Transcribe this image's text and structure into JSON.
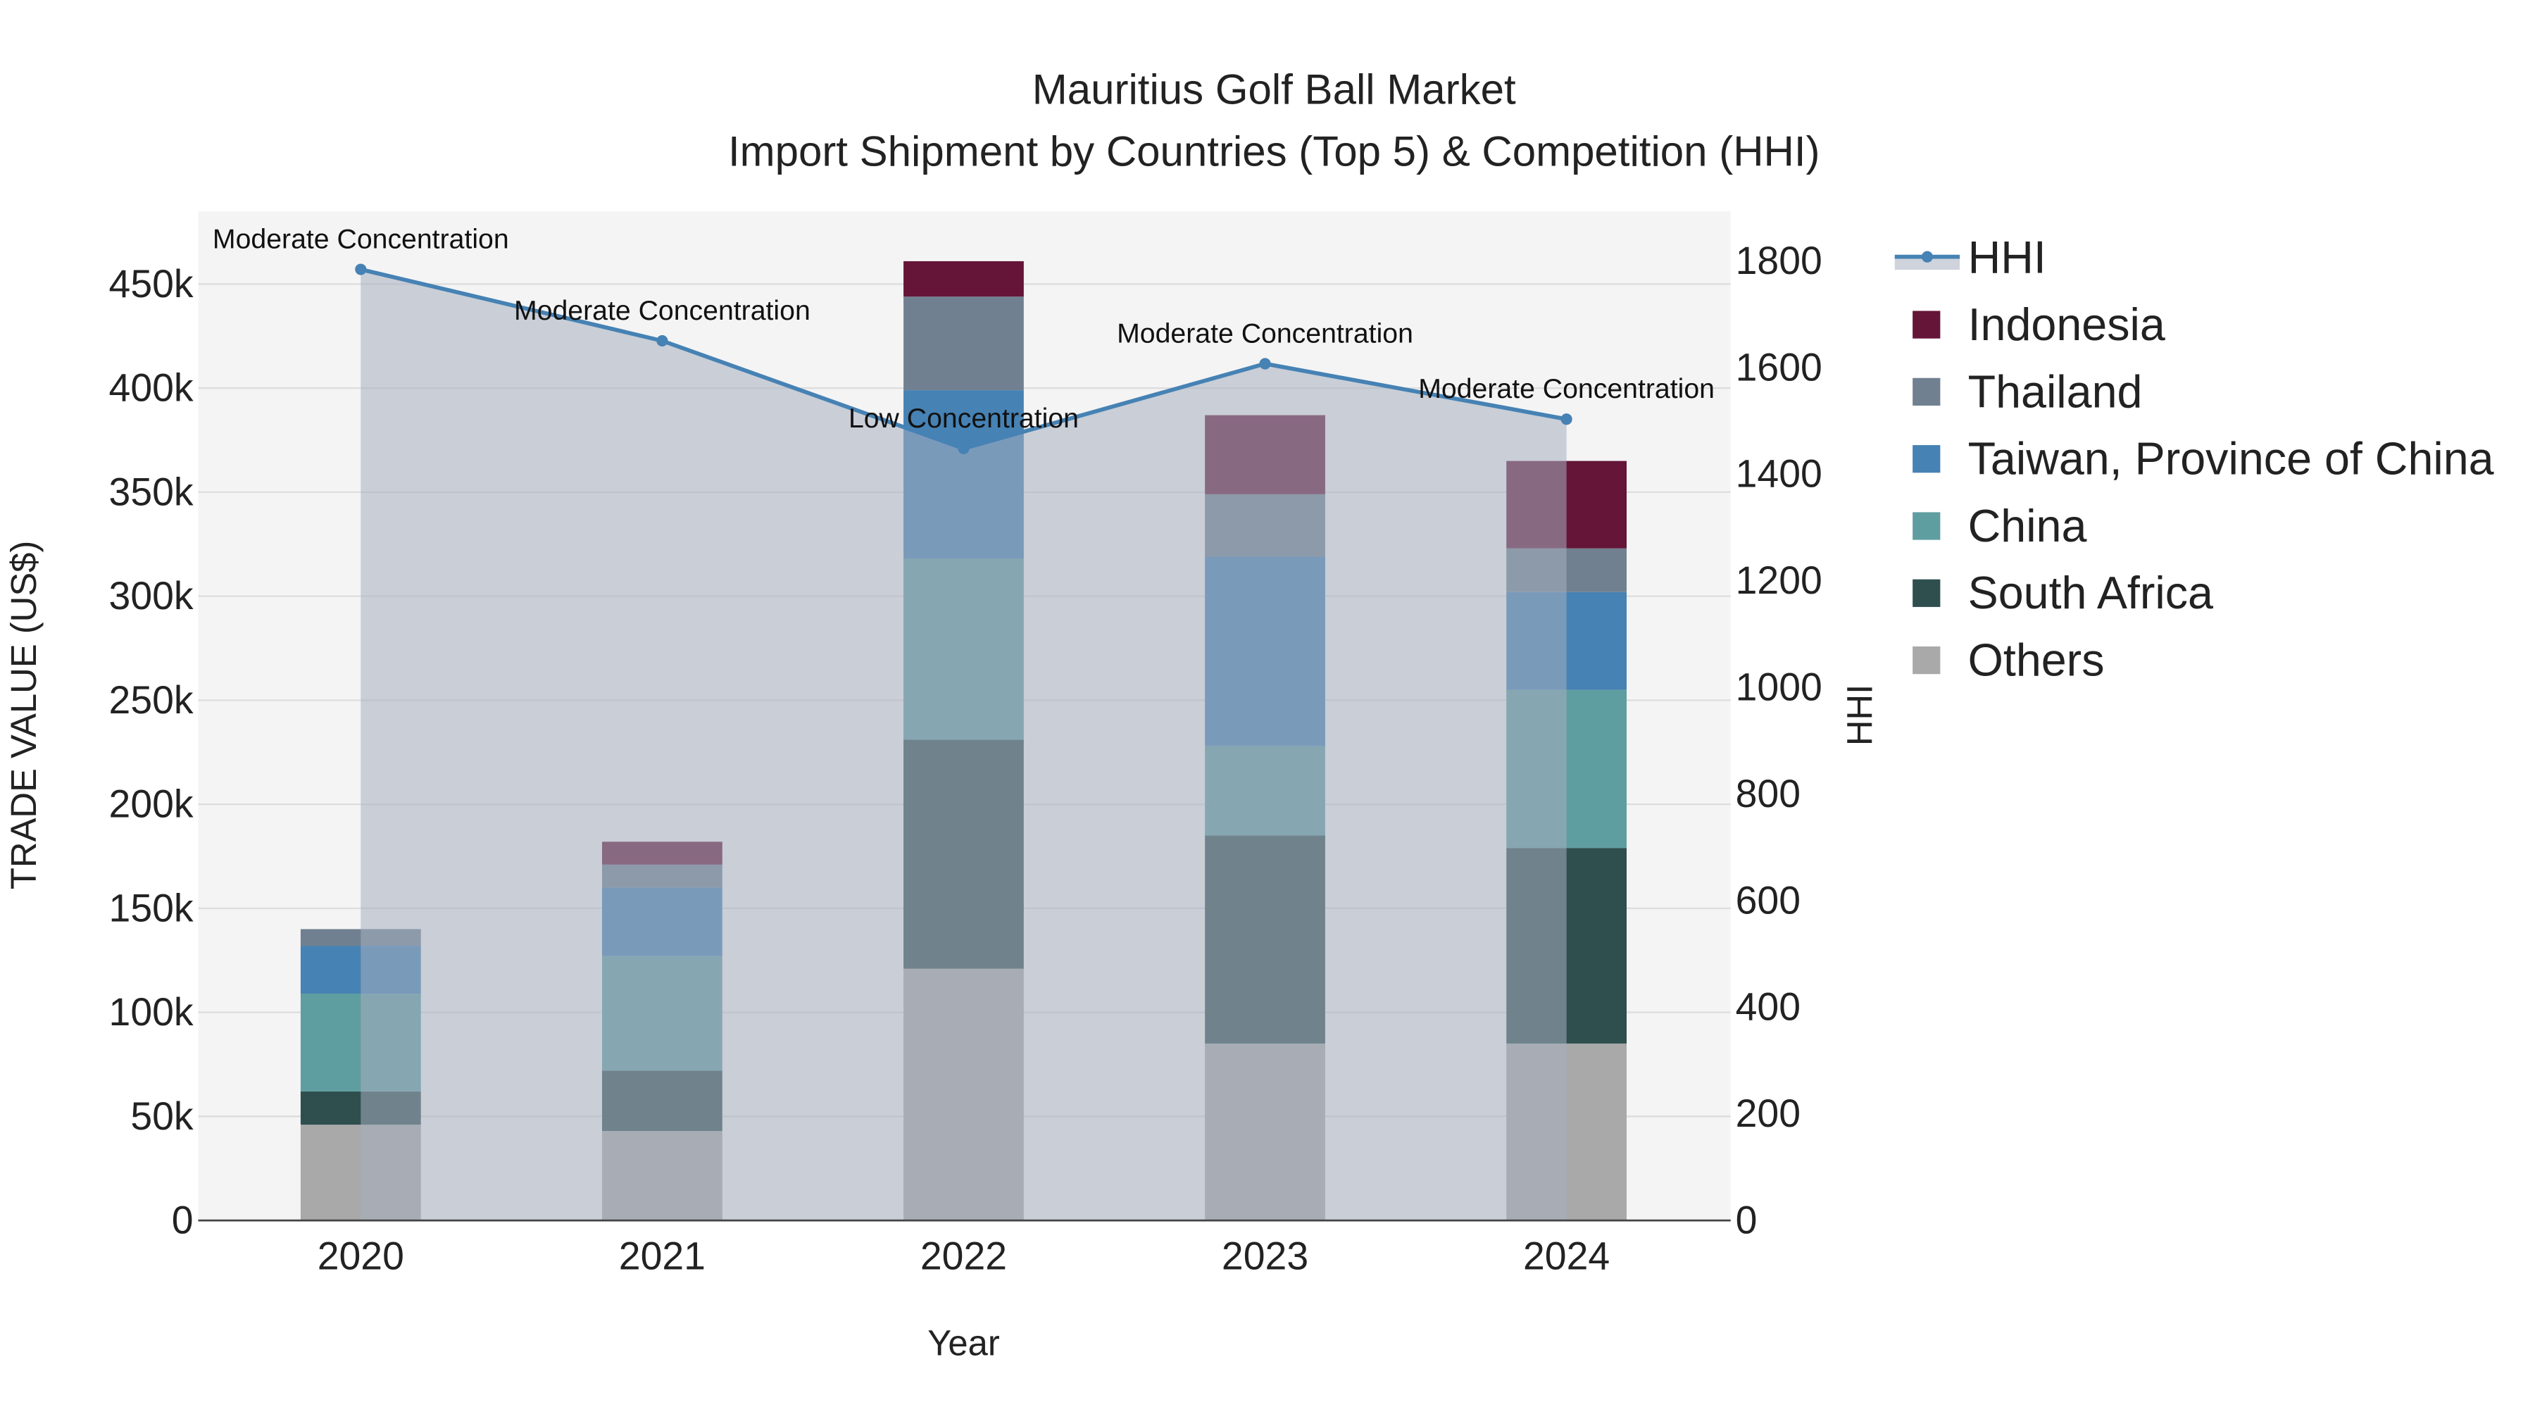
{
  "chart_data": {
    "type": "bar",
    "stacked": true,
    "title": "Mauritius Golf Ball Market",
    "subtitle": "Import Shipment by Countries (Top 5) & Competition (HHI)",
    "xlabel": "Year",
    "ylabel": "TRADE VALUE (US$)",
    "y2label": "HHI",
    "categories": [
      "2020",
      "2021",
      "2022",
      "2023",
      "2024"
    ],
    "ylim": [
      0,
      485000
    ],
    "y_ticks": [
      0,
      50000,
      100000,
      150000,
      200000,
      250000,
      300000,
      350000,
      400000,
      450000
    ],
    "y_tick_labels": [
      "0",
      "50k",
      "100k",
      "150k",
      "200k",
      "250k",
      "300k",
      "350k",
      "400k",
      "450k"
    ],
    "y2lim": [
      0,
      1893
    ],
    "y2_ticks": [
      0,
      200,
      400,
      600,
      800,
      1000,
      1200,
      1400,
      1600,
      1800
    ],
    "y2_tick_labels": [
      "0",
      "200",
      "400",
      "600",
      "800",
      "1000",
      "1200",
      "1400",
      "1600",
      "1800"
    ],
    "grid": true,
    "legend_position": "right",
    "series": [
      {
        "name": "Others",
        "color": "#a9a9a9",
        "values": [
          46000,
          43000,
          121000,
          85000,
          85000
        ]
      },
      {
        "name": "South Africa",
        "color": "#2f4f4f",
        "values": [
          16000,
          29000,
          110000,
          100000,
          94000
        ]
      },
      {
        "name": "China",
        "color": "#5f9ea0",
        "values": [
          47000,
          55000,
          87000,
          43000,
          76000
        ]
      },
      {
        "name": "Taiwan, Province of China",
        "color": "#4682b4",
        "values": [
          23000,
          33000,
          81000,
          91000,
          47000
        ]
      },
      {
        "name": "Thailand",
        "color": "#708090",
        "values": [
          8000,
          11000,
          45000,
          30000,
          21000
        ]
      },
      {
        "name": "Indonesia",
        "color": "#641538",
        "values": [
          0,
          11000,
          17000,
          38000,
          42000
        ]
      }
    ],
    "hhi": {
      "name": "HHI",
      "color": "#4682b4",
      "values": [
        1784,
        1650,
        1448,
        1607,
        1503
      ],
      "annotations": [
        "Moderate Concentration",
        "Moderate Concentration",
        "Low Concentration",
        "Moderate Concentration",
        "Moderate Concentration"
      ]
    },
    "legend_order": [
      "HHI",
      "Indonesia",
      "Thailand",
      "Taiwan, Province of China",
      "China",
      "South Africa",
      "Others"
    ]
  }
}
